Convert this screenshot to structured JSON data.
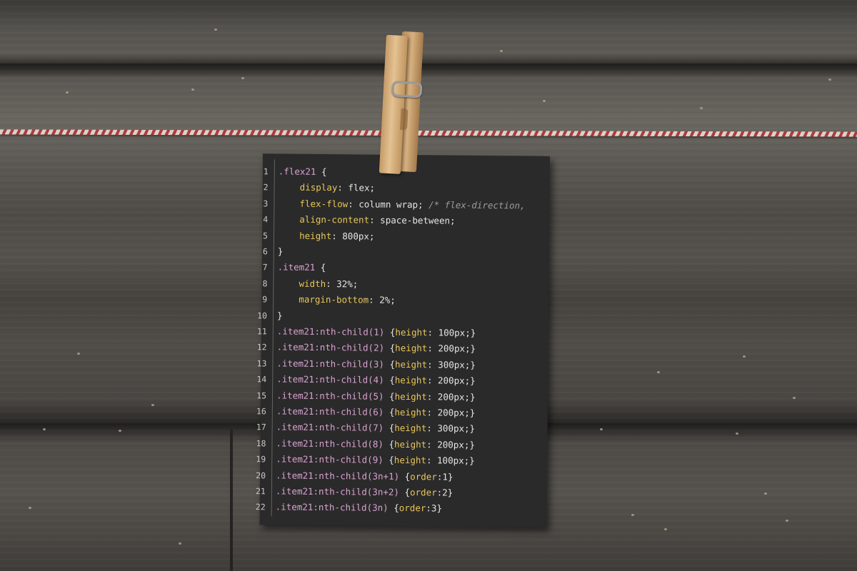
{
  "code_card": {
    "lines": [
      {
        "n": "1",
        "sel": ".flex21",
        "brace": " {",
        "indent": "",
        "prop": "",
        "val": "",
        "com": ""
      },
      {
        "n": "2",
        "sel": "",
        "brace": "",
        "indent": "    ",
        "prop": "display",
        "val": ": flex;",
        "com": ""
      },
      {
        "n": "3",
        "sel": "",
        "brace": "",
        "indent": "    ",
        "prop": "flex-flow",
        "val": ": column wrap; ",
        "com": "/* flex-direction,"
      },
      {
        "n": "4",
        "sel": "",
        "brace": "",
        "indent": "    ",
        "prop": "align-content",
        "val": ": space-between;",
        "com": ""
      },
      {
        "n": "5",
        "sel": "",
        "brace": "",
        "indent": "    ",
        "prop": "height",
        "val": ": 800px;",
        "com": ""
      },
      {
        "n": "6",
        "sel": "",
        "brace": "}",
        "indent": "",
        "prop": "",
        "val": "",
        "com": ""
      },
      {
        "n": "7",
        "sel": ".item21",
        "brace": " {",
        "indent": "",
        "prop": "",
        "val": "",
        "com": ""
      },
      {
        "n": "8",
        "sel": "",
        "brace": "",
        "indent": "    ",
        "prop": "width",
        "val": ": 32%;",
        "com": ""
      },
      {
        "n": "9",
        "sel": "",
        "brace": "",
        "indent": "    ",
        "prop": "margin-bottom",
        "val": ": 2%;",
        "com": ""
      },
      {
        "n": "10",
        "sel": "",
        "brace": "}",
        "indent": "",
        "prop": "",
        "val": "",
        "com": ""
      },
      {
        "n": "11",
        "sel": ".item21:nth-child(1)",
        "brace": " {",
        "indent": "",
        "prop": "height",
        "val": ": 100px;}",
        "com": ""
      },
      {
        "n": "12",
        "sel": ".item21:nth-child(2)",
        "brace": " {",
        "indent": "",
        "prop": "height",
        "val": ": 200px;}",
        "com": ""
      },
      {
        "n": "13",
        "sel": ".item21:nth-child(3)",
        "brace": " {",
        "indent": "",
        "prop": "height",
        "val": ": 300px;}",
        "com": ""
      },
      {
        "n": "14",
        "sel": ".item21:nth-child(4)",
        "brace": " {",
        "indent": "",
        "prop": "height",
        "val": ": 200px;}",
        "com": ""
      },
      {
        "n": "15",
        "sel": ".item21:nth-child(5)",
        "brace": " {",
        "indent": "",
        "prop": "height",
        "val": ": 200px;}",
        "com": ""
      },
      {
        "n": "16",
        "sel": ".item21:nth-child(6)",
        "brace": " {",
        "indent": "",
        "prop": "height",
        "val": ": 200px;}",
        "com": ""
      },
      {
        "n": "17",
        "sel": ".item21:nth-child(7)",
        "brace": " {",
        "indent": "",
        "prop": "height",
        "val": ": 300px;}",
        "com": ""
      },
      {
        "n": "18",
        "sel": ".item21:nth-child(8)",
        "brace": " {",
        "indent": "",
        "prop": "height",
        "val": ": 200px;}",
        "com": ""
      },
      {
        "n": "19",
        "sel": ".item21:nth-child(9)",
        "brace": " {",
        "indent": "",
        "prop": "height",
        "val": ": 100px;}",
        "com": ""
      },
      {
        "n": "20",
        "sel": ".item21:nth-child(3n+1)",
        "brace": " {",
        "indent": "",
        "prop": "order",
        "val": ":1}",
        "com": ""
      },
      {
        "n": "21",
        "sel": ".item21:nth-child(3n+2)",
        "brace": " {",
        "indent": "",
        "prop": "order",
        "val": ":2}",
        "com": ""
      },
      {
        "n": "22",
        "sel": ".item21:nth-child(3n)",
        "brace": " {",
        "indent": "",
        "prop": "order",
        "val": ":3}",
        "com": ""
      }
    ]
  },
  "colors": {
    "selector": "#d7a3d0",
    "property": "#e8c65a",
    "value": "#e6e6e6",
    "comment": "#9c9c9c",
    "card_background": "#2a2a2a",
    "string_red": "#b23a3a",
    "clothespin_wood": "#d6b080"
  },
  "scene": {
    "background": "weathered-wood-planks",
    "string": "red-white-twine",
    "clip": "wooden-clothespin"
  }
}
